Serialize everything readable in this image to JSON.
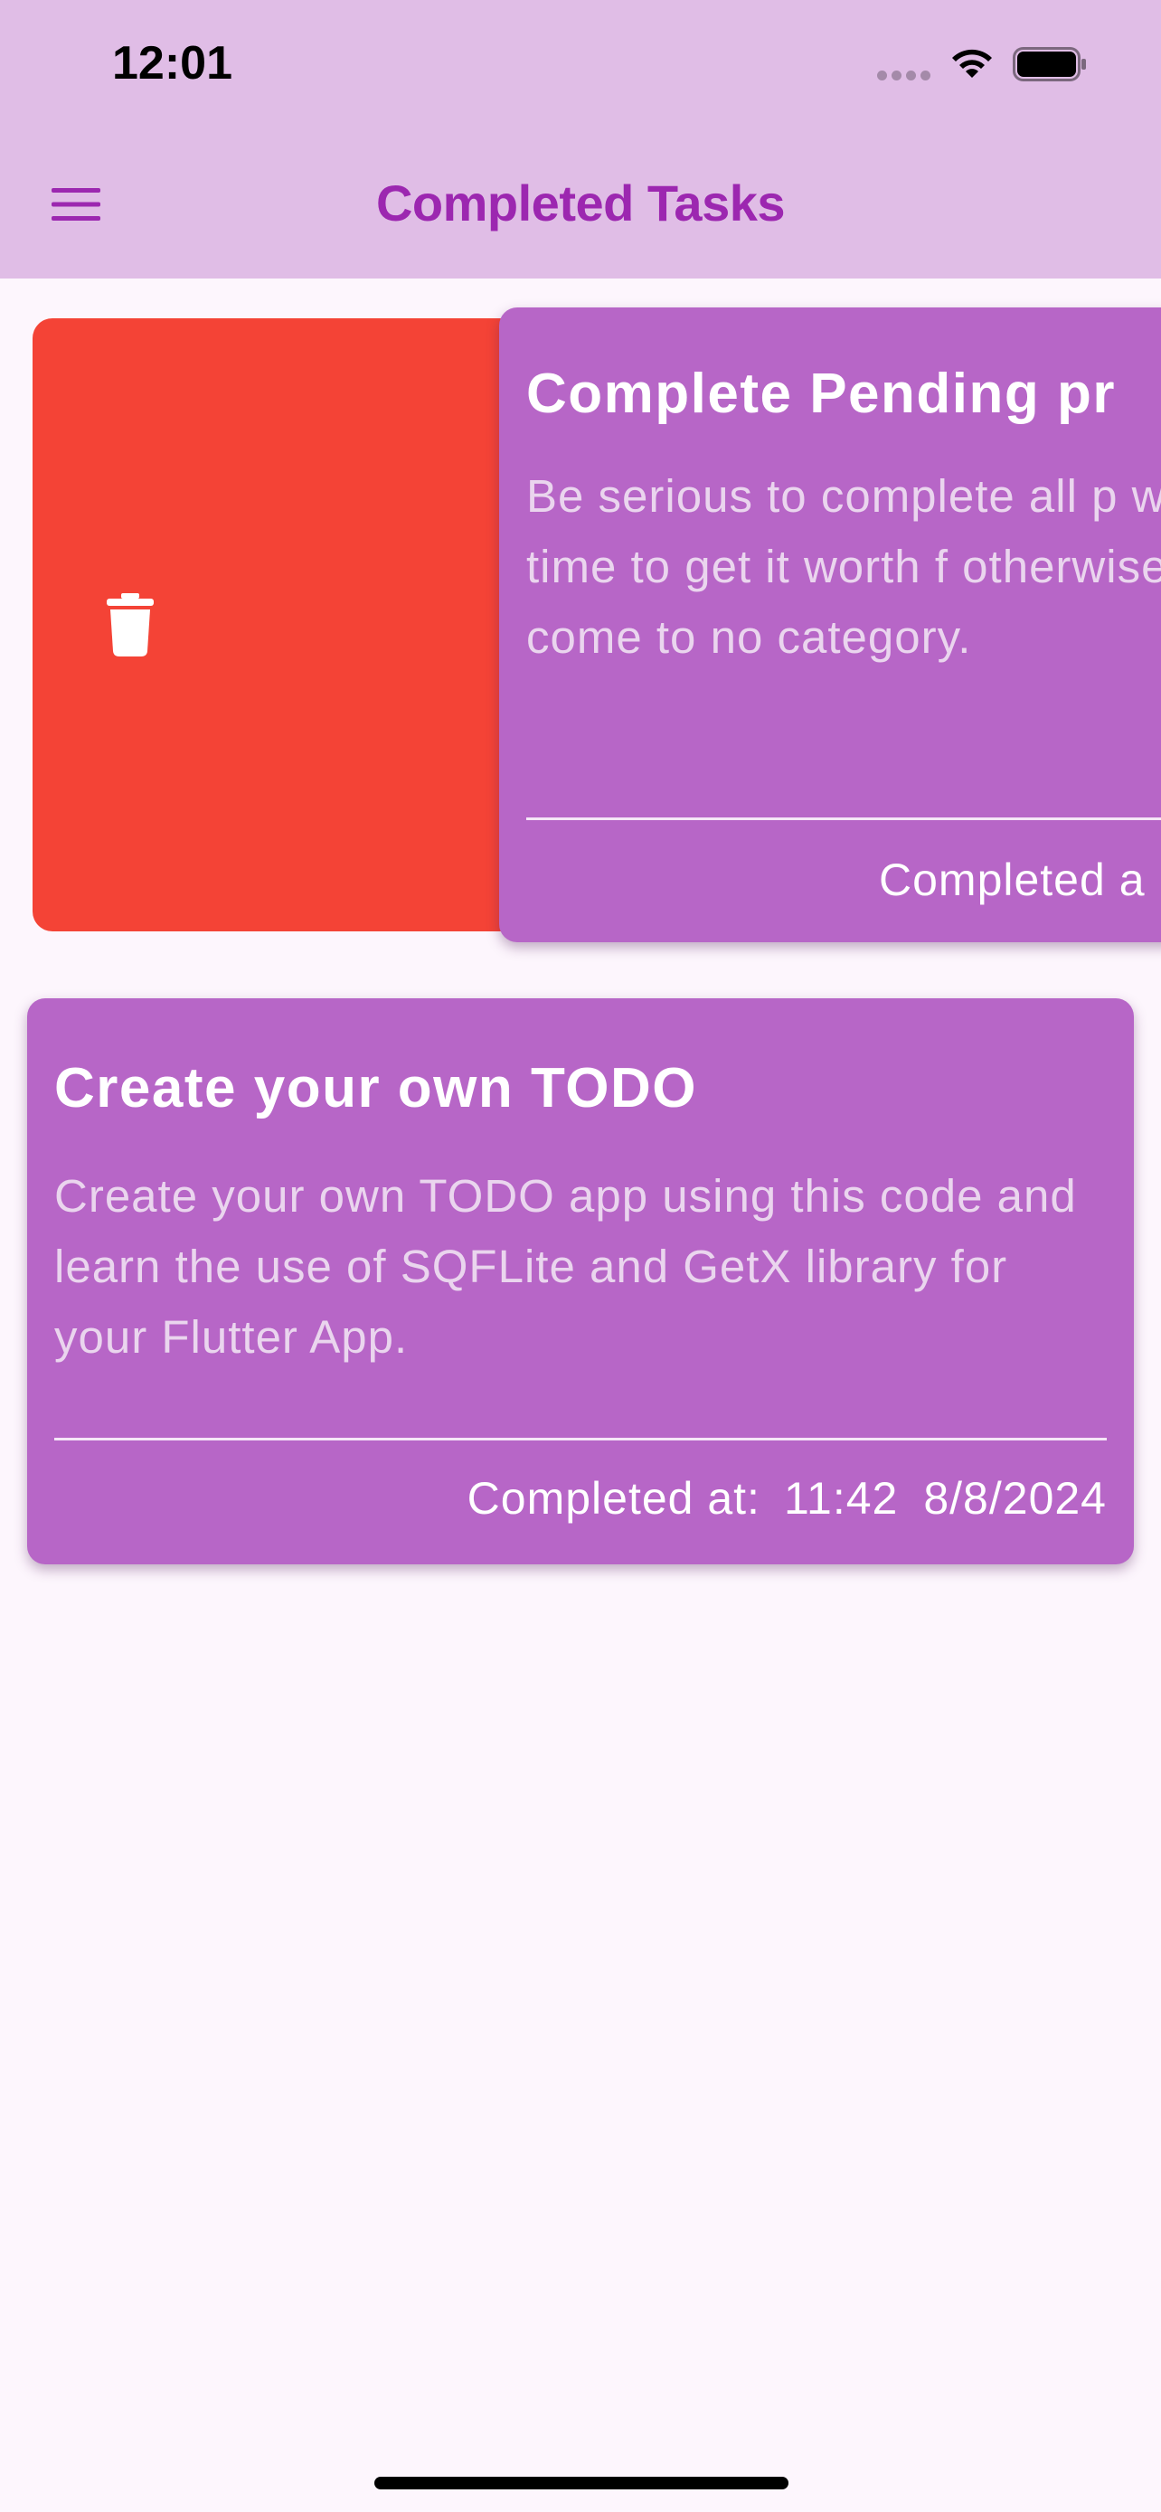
{
  "status_bar": {
    "time": "12:01"
  },
  "app_bar": {
    "title": "Completed Tasks",
    "menu_icon": "hamburger-menu-icon"
  },
  "colors": {
    "app_bar_bg": "#e0bde6",
    "accent": "#9c27b0",
    "card_bg": "#b766c7",
    "delete_bg": "#f44336",
    "page_bg": "#fdf6fd"
  },
  "swipe_action": {
    "icon": "trash-icon"
  },
  "tasks": [
    {
      "title": "Complete Pending pr",
      "description": "Be serious to complete all p within time to get it worth f otherwise it will come to no category.",
      "completed_label": "Completed a",
      "swiped": true
    },
    {
      "title": "Create your own TODO",
      "description": "Create your own TODO app using this code and learn the use of SQFLite and GetX library for your Flutter App.",
      "completed_label": "Completed at:",
      "completed_time": "11:42",
      "completed_date": "8/8/2024",
      "swiped": false
    }
  ]
}
